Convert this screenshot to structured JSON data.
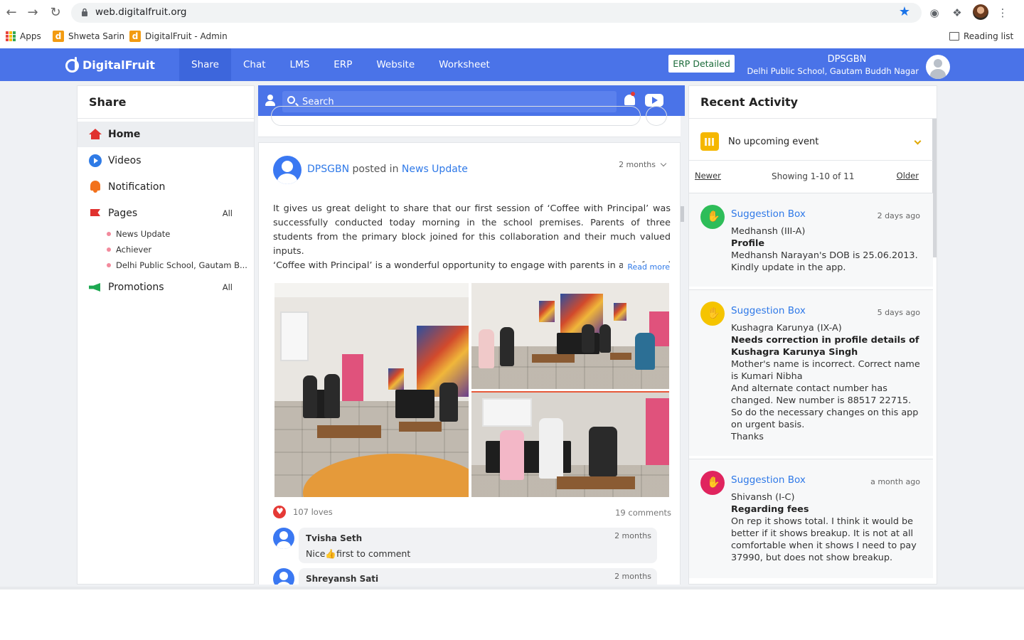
{
  "browser": {
    "url": "web.digitalfruit.org",
    "bookmarks": [
      "Apps",
      "Shweta Sarin",
      "DigitalFruit - Admin"
    ],
    "reading_list": "Reading list"
  },
  "header": {
    "brand": "DigitalFruit",
    "nav": [
      "Share",
      "Chat",
      "LMS",
      "ERP",
      "Website",
      "Worksheet"
    ],
    "erp_button": "ERP Detailed",
    "school_code": "DPSGBN",
    "school_name": "Delhi Public School, Gautam Buddh Nagar"
  },
  "sidebar": {
    "title": "Share",
    "items": {
      "home": "Home",
      "videos": "Videos",
      "notification": "Notification",
      "pages": "Pages",
      "pages_all": "All",
      "promotions": "Promotions",
      "promotions_all": "All"
    },
    "sub_pages": [
      "News Update",
      "Achiever",
      "Delhi Public School, Gautam B..."
    ]
  },
  "feed": {
    "search_placeholder": "Search",
    "post": {
      "author": "DPSGBN",
      "posted_in": "posted in",
      "page": "News Update",
      "time": "2 months",
      "text_1": "It gives us great delight to share that our first session of ‘Coffee with Principal’ was successfully conducted today morning in the school premises. Parents of three students from the primary block joined for this collaboration and their much valued inputs.",
      "text_2": "‘Coffee with Principal’ is a wonderful opportunity to engage with parents in an informal conversation about the functioning of the school and discuss over their ex",
      "read_more": "Read more",
      "loves": "107 loves",
      "comments": "19 comments"
    },
    "comments": [
      {
        "name": "Tvisha Seth",
        "time": "2 months",
        "text": "Nice👍first to comment"
      },
      {
        "name": "Shreyansh Sati",
        "time": "2 months",
        "text": ""
      }
    ]
  },
  "activity": {
    "title": "Recent Activity",
    "event": "No upcoming event",
    "newer": "Newer",
    "showing": "Showing 1-10 of 11",
    "older": "Older",
    "items": [
      {
        "type": "Suggestion Box",
        "time": "2 days ago",
        "from": "Medhansh (III-A)",
        "subject": "Profile",
        "message": "Medhansh Narayan's DOB is 25.06.2013. Kindly update in the app.",
        "color": "#2ebd59"
      },
      {
        "type": "Suggestion Box",
        "time": "5 days ago",
        "from": "Kushagra Karunya (IX-A)",
        "subject": "Needs correction in profile details of Kushagra Karunya Singh",
        "message": "Mother's name is incorrect.  Correct name is Kumari Nibha\nAnd alternate contact number has changed.  New number is 88517 22715.\nSo do the necessary changes on this app on urgent basis.\nThanks",
        "color": "#f5c400"
      },
      {
        "type": "Suggestion Box",
        "time": "a month ago",
        "from": "Shivansh (I-C)",
        "subject": "Regarding fees",
        "message": "On rep it shows total. I think it would be better if it shows breakup. It is not at all comfortable when it shows I need to pay 37990, but does not show breakup.",
        "color": "#e0245e"
      }
    ]
  },
  "colors": {
    "header_blue": "#4a73e8",
    "link_blue": "#2f79e8"
  }
}
